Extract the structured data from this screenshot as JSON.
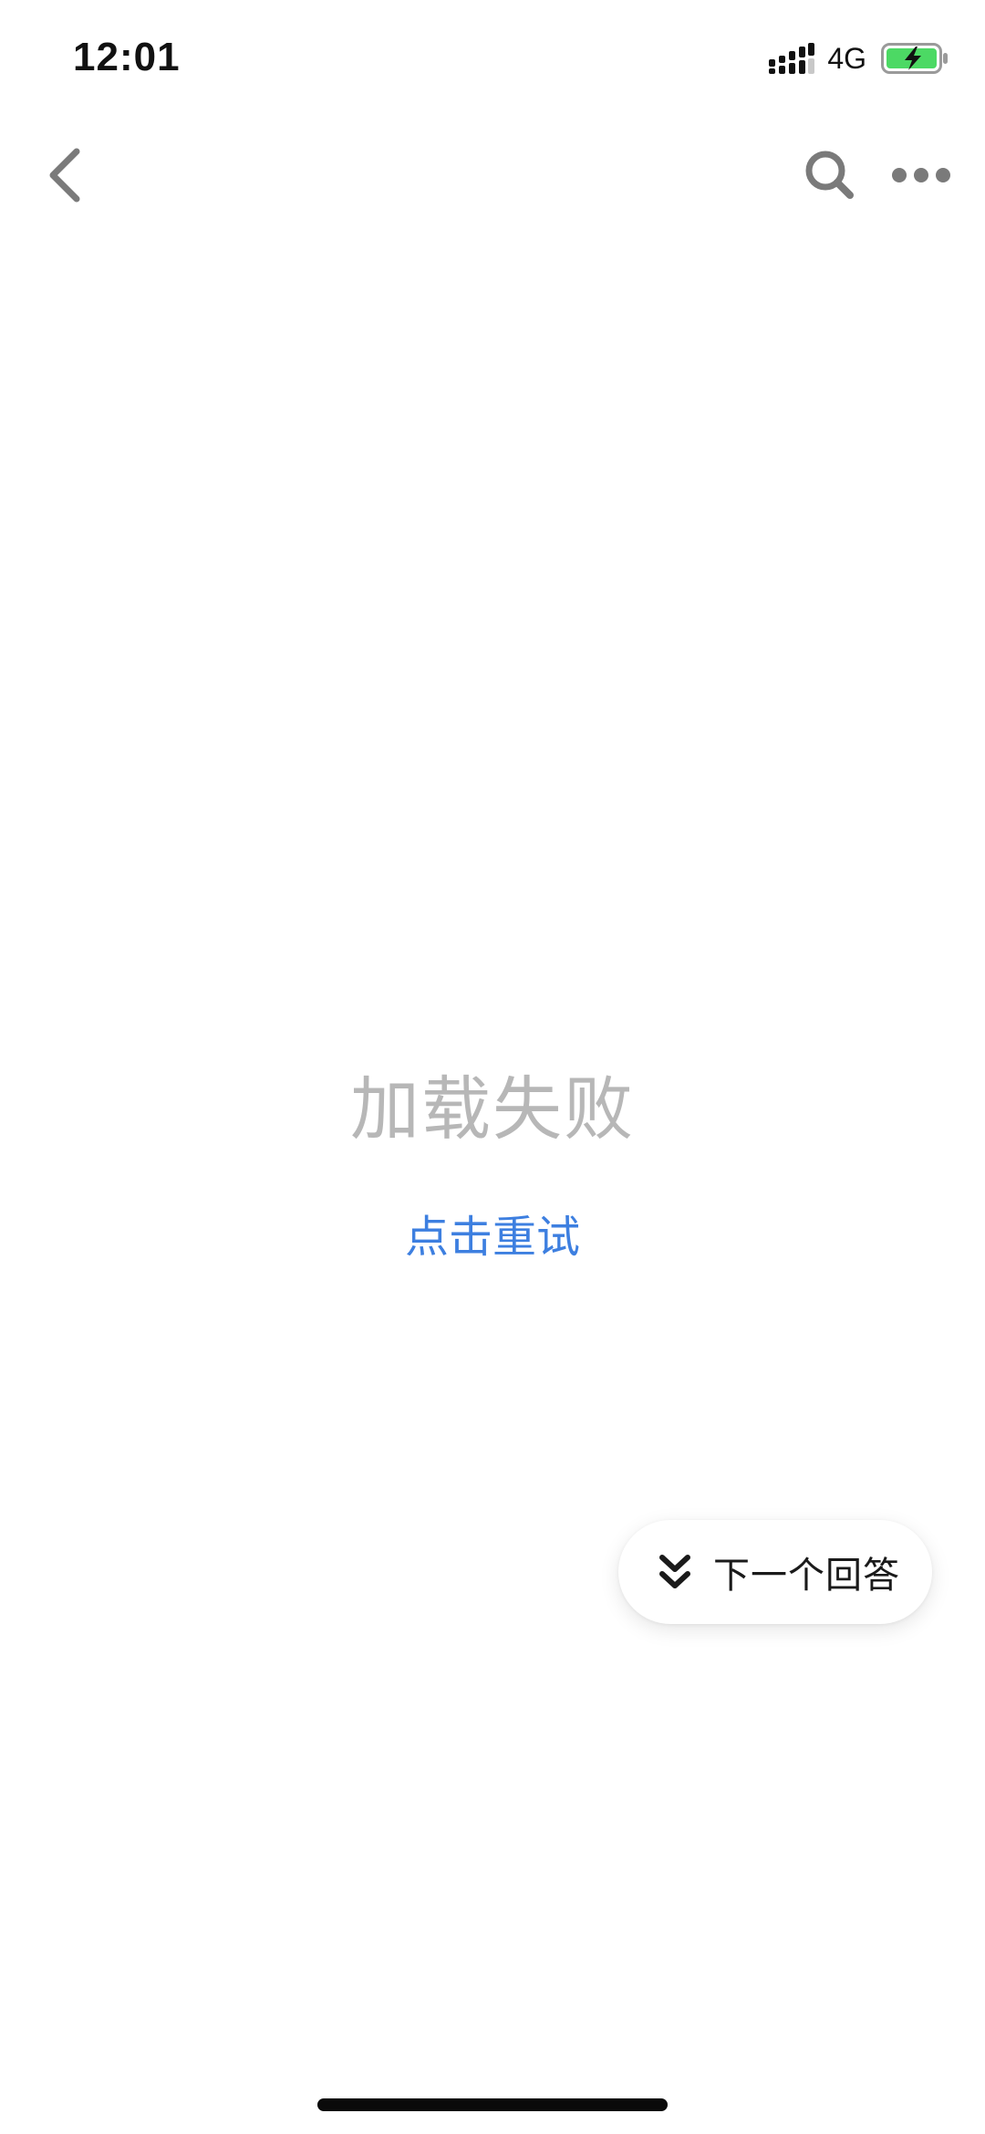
{
  "status_bar": {
    "time": "12:01",
    "network": "4G",
    "signal_icon": "signal-bars-icon",
    "battery_icon": "battery-charging-icon",
    "battery_color": "#4cd964"
  },
  "nav": {
    "back_icon": "chevron-left-icon",
    "search_icon": "search-icon",
    "more_icon": "more-horizontal-icon",
    "icon_color": "#7a7a7a"
  },
  "content": {
    "error_title": "加载失败",
    "retry_label": "点击重试",
    "retry_color": "#3d7fe0",
    "error_color": "#b7b7b7"
  },
  "floating_button": {
    "label": "下一个回答",
    "icon": "double-chevron-down-icon"
  }
}
